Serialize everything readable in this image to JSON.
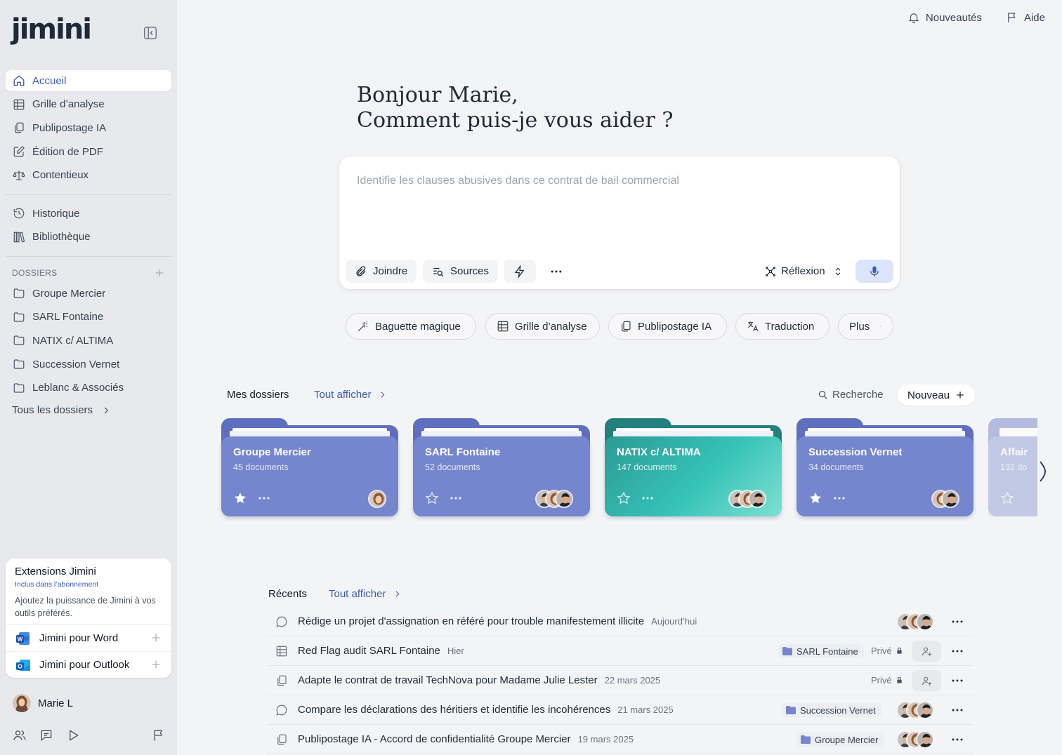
{
  "app": {
    "logo": "jimini"
  },
  "sidebar": {
    "nav": [
      {
        "label": "Accueil",
        "icon": "home-icon",
        "active": true
      },
      {
        "label": "Grille d’analyse",
        "icon": "grid-icon"
      },
      {
        "label": "Publipostage IA",
        "icon": "copy-icon"
      },
      {
        "label": "Édition de PDF",
        "icon": "edit-icon"
      },
      {
        "label": "Contentieux",
        "icon": "scale-icon"
      }
    ],
    "nav2": [
      {
        "label": "Historique",
        "icon": "history-icon"
      },
      {
        "label": "Bibliothèque",
        "icon": "library-icon"
      }
    ],
    "dossiers_header": "DOSSIERS",
    "dossiers": [
      "Groupe Mercier",
      "SARL Fontaine",
      "NATIX c/ ALTIMA",
      "Succession Vernet",
      "Leblanc & Associés"
    ],
    "all_dossiers": "Tous les dossiers",
    "extensions": {
      "title": "Extensions Jimini",
      "subtitle": "Inclus dans l’abonnement",
      "description": "Ajoutez la puissance de Jimini à vos outils préférés.",
      "items": [
        "Jimini pour Word",
        "Jimini pour Outlook"
      ]
    },
    "user": {
      "name": "Marie L"
    }
  },
  "topbar": {
    "news": "Nouveautés",
    "help": "Aide"
  },
  "greeting": {
    "line1": "Bonjour Marie,",
    "line2": "Comment puis-je vous aider ?"
  },
  "prompt": {
    "placeholder": "Identifie les clauses abusives dans ce contrat de bail commercial",
    "attach": "Joindre",
    "sources": "Sources",
    "mode": "Réflexion"
  },
  "chips": [
    "Baguette magique",
    "Grille d’analyse",
    "Publipostage IA",
    "Traduction",
    "Plus"
  ],
  "dossiers_section": {
    "title": "Mes dossiers",
    "see_all": "Tout afficher",
    "search": "Recherche",
    "new": "Nouveau",
    "folders": [
      {
        "name": "Groupe Mercier",
        "count": "45 documents",
        "starred": true,
        "color": "#7586cf"
      },
      {
        "name": "SARL Fontaine",
        "count": "52 documents",
        "starred": false,
        "color": "#7586cf"
      },
      {
        "name": "NATIX c/ ALTIMA",
        "count": "147 documents",
        "starred": false,
        "color": "#2fb3aa"
      },
      {
        "name": "Succession Vernet",
        "count": "34 documents",
        "starred": true,
        "color": "#7586cf"
      },
      {
        "name": "Affair",
        "count": "132 do",
        "starred": false,
        "color": "#9aa6d8"
      }
    ]
  },
  "recents_section": {
    "title": "Récents",
    "see_all": "Tout afficher",
    "items": [
      {
        "title": "Rédige un projet d'assignation en référé pour trouble manifestement illicite",
        "date": "Aujourd’hui",
        "icon": "chat-icon"
      },
      {
        "title": "Red Flag audit SARL Fontaine",
        "date": "Hier",
        "folder": "SARL Fontaine",
        "privacy": "Privé",
        "icon": "grid-icon"
      },
      {
        "title": "Adapte le contrat de travail TechNova pour Madame Julie Lester",
        "date": "22 mars 2025",
        "privacy": "Privé",
        "icon": "copy-icon"
      },
      {
        "title": "Compare les déclarations des héritiers et identifie les incohérences",
        "date": "21 mars 2025",
        "folder": "Succession Vernet",
        "icon": "chat-icon"
      },
      {
        "title": "Publipostage IA - Accord de confidentialité Groupe Mercier",
        "date": "19 mars 2025",
        "folder": "Groupe Mercier",
        "icon": "copy-icon"
      }
    ]
  },
  "colors": {
    "accent": "#3b5bb5",
    "folder_blue": "#7586cf",
    "folder_teal": "#2fb3aa"
  }
}
